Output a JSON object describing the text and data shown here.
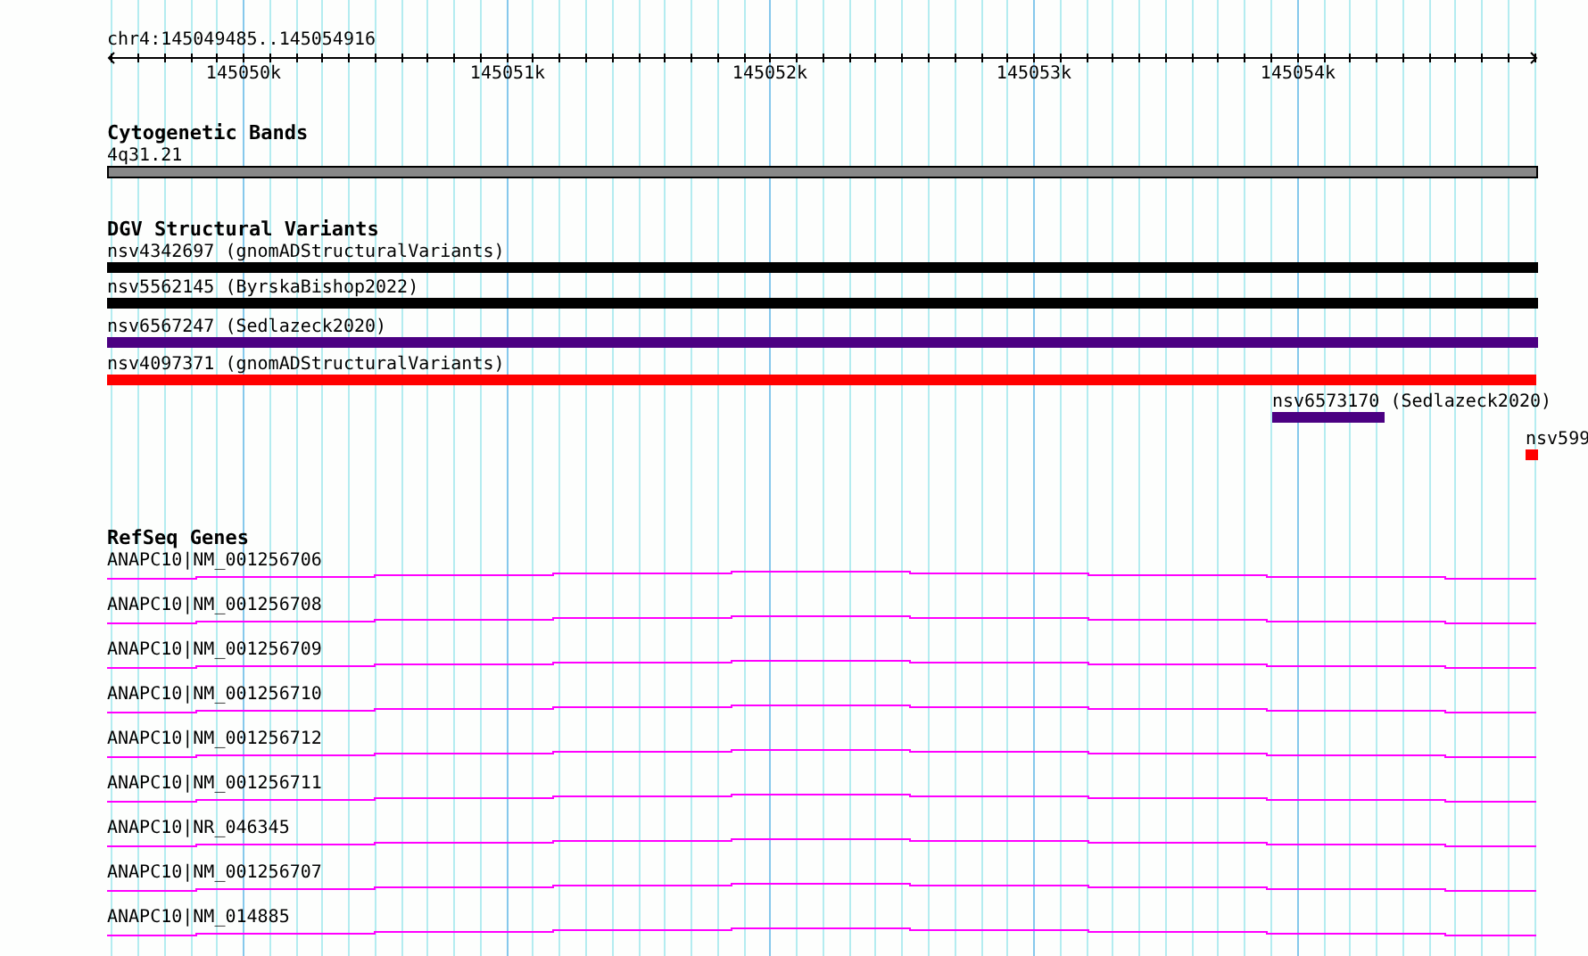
{
  "location": "chr4:145049485..145054916",
  "ruler": {
    "labels": [
      "145050k",
      "145051k",
      "145052k",
      "145053k",
      "145054k"
    ]
  },
  "tracks": [
    {
      "kind": "bands",
      "title": "Cytogenetic Bands",
      "features": [
        {
          "label": "4q31.21"
        }
      ]
    },
    {
      "kind": "variants",
      "title": "DGV Structural Variants",
      "features": [
        {
          "label": "nsv4342697 (gnomADStructuralVariants)",
          "color": "#000000"
        },
        {
          "label": "nsv5562145 (ByrskaBishop2022)",
          "color": "#000000"
        },
        {
          "label": "nsv6567247 (Sedlazeck2020)",
          "color": "#4b0082"
        },
        {
          "label": "nsv4097371 (gnomADStructuralVariants)",
          "color": "#ff0000"
        },
        {
          "label": "nsv6573170 (Sedlazeck2020)",
          "color": "#4b0082"
        },
        {
          "label": "nsv599",
          "color": "#ff0000"
        }
      ]
    },
    {
      "kind": "genes",
      "title": "RefSeq Genes",
      "features": [
        {
          "label": "ANAPC10|NM_001256706"
        },
        {
          "label": "ANAPC10|NM_001256708"
        },
        {
          "label": "ANAPC10|NM_001256709"
        },
        {
          "label": "ANAPC10|NM_001256710"
        },
        {
          "label": "ANAPC10|NM_001256712"
        },
        {
          "label": "ANAPC10|NM_001256711"
        },
        {
          "label": "ANAPC10|NR_046345"
        },
        {
          "label": "ANAPC10|NM_001256707"
        },
        {
          "label": "ANAPC10|NM_014885"
        }
      ]
    }
  ]
}
